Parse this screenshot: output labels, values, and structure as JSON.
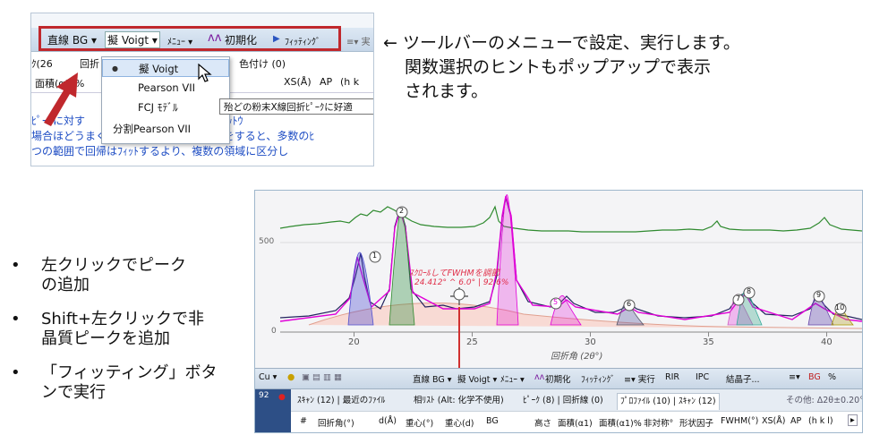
{
  "toolbar_top": {
    "bg_label": "直線 BG ▾",
    "func_label": "擬 Voigt ▾",
    "menu_label": "ﾒﾆｭｰ ▾",
    "init_label": "初期化",
    "fit_label": "ﾌｨｯﾃｨﾝｸﾞ",
    "right_cut": "≡▾ 実"
  },
  "sub_top": {
    "row1a": "ｸ(26",
    "row1b": "回折",
    "row1c": "色付け (0)",
    "row2a": "面積(α1)%",
    "row2b": "XS(Å)",
    "row2c": "AP",
    "row2d": "(h k"
  },
  "dropdown": {
    "options": [
      "擬 Voigt",
      "Pearson VII",
      "FCJ ﾓﾃﾞﾙ",
      "分割Pearson VII"
    ],
    "selected_index": 0
  },
  "tooltip": "殆どの粉末X線回折ﾋﾟｰｸに好適",
  "top_left_text": [
    "ﾋﾟｰｸに対す　　　　　　　ｰｸ分解) はﾌﾟﾛｯﾄｳ",
    "場合ほどうまく機能します。別の言い方をすると、多数のﾋ",
    "つの範囲で回帰はﾌｨｯﾄするより、複数の領域に区分し"
  ],
  "note_lines": [
    "← ツールバーのメニューで設定、実行します。",
    "関数選択のヒントもポップアップで表示",
    "されます。"
  ],
  "bullets": [
    [
      "左クリックでピーク",
      "の追加"
    ],
    [
      "Shift+左クリックで非",
      "晶質ピークを追加"
    ],
    [
      "「フィッティング」ボタ",
      "ンで実行"
    ]
  ],
  "bullet_mark": "•",
  "plot": {
    "y_tick": "500",
    "y_zero": "0",
    "x_ticks": [
      "20",
      "25",
      "30",
      "35",
      "40"
    ],
    "x_label": "回折角 (2θ°)",
    "hint_line1": "ｽｸﾛｰﾙしてFWHMを調節",
    "hint_line2": "24.412° ^ 6.0° | 92.6%",
    "peak_labels": [
      "1",
      "2",
      "5",
      "6",
      "7",
      "8",
      "9",
      "10"
    ]
  },
  "toolbar_bottom": {
    "items": [
      "Cu ▾",
      "直線 BG ▾",
      "擬 Voigt ▾",
      "ﾒﾆｭｰ ▾",
      "初期化",
      "ﾌｨｯﾃｨﾝｸﾞ",
      "≡▾ 実行",
      "RIR",
      "IPC",
      "結晶子...",
      "≡▾",
      "BG",
      "%"
    ]
  },
  "tabs_bottom": {
    "items": [
      "ｽｷｬﾝ (12) | 最近のﾌｧｲﾙ",
      "相ﾘｽﾄ (Alt: 化学不使用)",
      "ﾋﾟｰｸ (8) | 回折線 (0)",
      "ﾌﾟﾛﾌｧｲﾙ (10) | ｽｷｬﾝ (12)"
    ],
    "right": "その他:  Δ2θ±0.20°",
    "left_num": "92"
  },
  "columns": [
    "#",
    "回折角(°)",
    "d(Å)",
    "重心(°)",
    "重心(d)",
    "BG",
    "高さ",
    "面積(α1)",
    "面積(α1)%",
    "非対称°",
    "形状因子",
    "FWHM(°)",
    "XS(Å)",
    "AP",
    "(h k l)"
  ],
  "colors": {
    "highlight": "#c0282d",
    "toolbar_blue": "#c6d6e8",
    "link_blue": "#1f4ec4",
    "magenta": "#e100d8",
    "green_curve": "#2f8a2f",
    "navy_curve": "#23235f"
  }
}
